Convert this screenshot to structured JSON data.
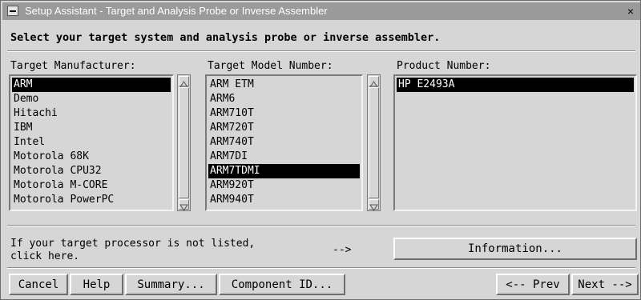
{
  "window": {
    "title": "Setup Assistant - Target and Analysis Probe or Inverse Assembler",
    "close_glyph": "×"
  },
  "instruction": "Select your target system and analysis probe or inverse assembler.",
  "manufacturer": {
    "label": "Target Manufacturer:",
    "items": [
      "ARM",
      "Demo",
      "Hitachi",
      "IBM",
      "Intel",
      "Motorola 68K",
      "Motorola CPU32",
      "Motorola M-CORE",
      "Motorola PowerPC"
    ],
    "selected": "ARM"
  },
  "model": {
    "label": "Target Model Number:",
    "items": [
      "ARM ETM",
      "ARM6",
      "ARM710T",
      "ARM720T",
      "ARM740T",
      "ARM7DI",
      "ARM7TDMI",
      "ARM920T",
      "ARM940T"
    ],
    "selected": "ARM7TDMI"
  },
  "product": {
    "label": "Product Number:",
    "items": [
      "HP E2493A"
    ],
    "selected": "HP E2493A"
  },
  "not_listed": {
    "line1": "If your target processor is not listed,",
    "line2": "click here.",
    "arrow": "-->"
  },
  "buttons": {
    "information": "Information...",
    "cancel": "Cancel",
    "help": "Help",
    "summary": "Summary...",
    "component_id": "Component ID...",
    "prev": "<-- Prev",
    "next": "Next -->"
  }
}
